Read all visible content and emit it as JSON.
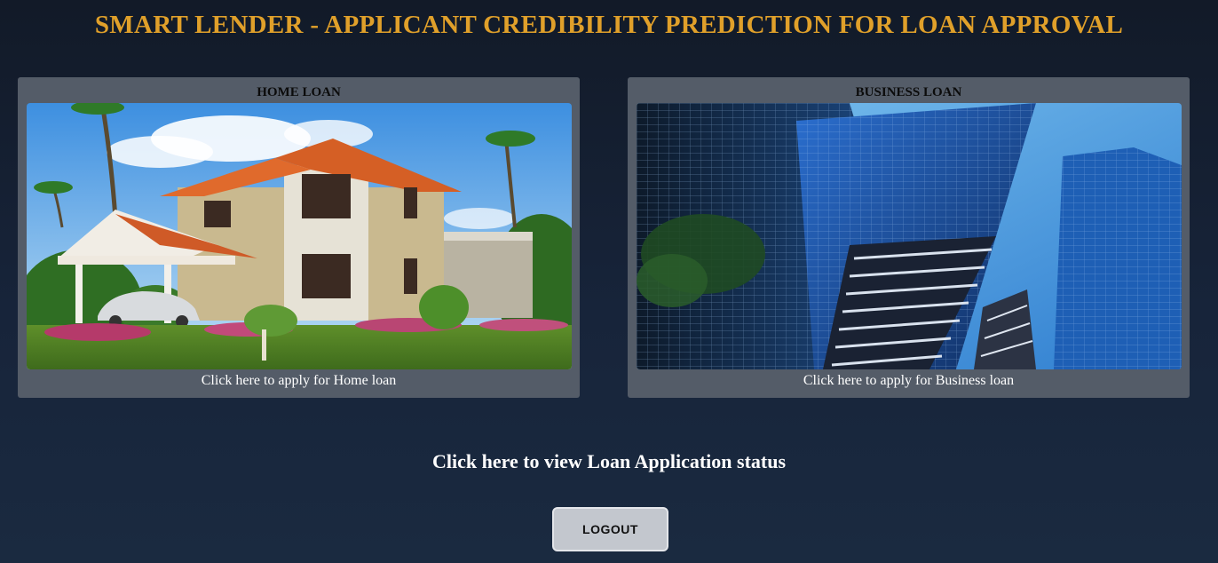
{
  "header": {
    "title": "SMART LENDER - APPLICANT CREDIBILITY PREDICTION FOR LOAN APPROVAL"
  },
  "cards": [
    {
      "heading": "HOME LOAN",
      "link_text": "Click here to apply for Home loan",
      "image": "house-photo"
    },
    {
      "heading": "BUSINESS LOAN",
      "link_text": "Click here to apply for Business loan",
      "image": "skyscrapers-photo"
    }
  ],
  "status_link": "Click here to view Loan Application status",
  "logout_label": "LOGOUT",
  "colors": {
    "title": "#e0a02a",
    "card_bg": "#545c68",
    "background": "#17243a",
    "button_bg": "#c3c7ce"
  }
}
